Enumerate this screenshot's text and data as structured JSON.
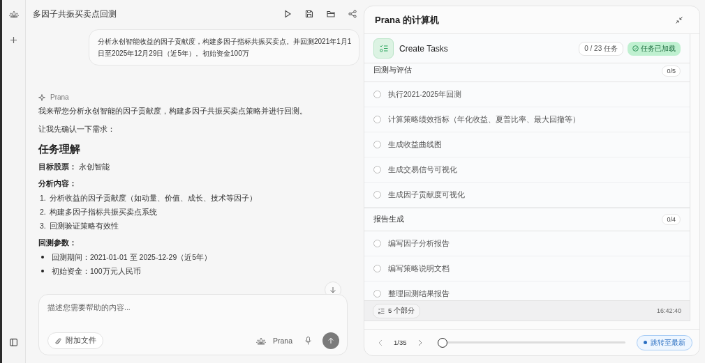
{
  "chat": {
    "title": "多因子共振买卖点回测",
    "user_message": "分析永创智能收益的因子贡献度，构建多因子指标共振买卖点。并回测2021年1月1日至2025年12月29日（近5年）。初始资金100万",
    "assistant_name": "Prana",
    "blocks": [
      {
        "kind": "p",
        "text": "我来帮您分析永创智能的因子贡献度，构建多因子共振买卖点策略并进行回测。"
      },
      {
        "kind": "p",
        "text": "让我先确认一下需求："
      },
      {
        "kind": "h",
        "text": "任务理解"
      },
      {
        "kind": "p",
        "text": "**目标股票：** 永创智能"
      },
      {
        "kind": "label",
        "text": "分析内容："
      },
      {
        "kind": "ol",
        "items": [
          {
            "number": "1.",
            "text": "分析收益的因子贡献度（如动量、价值、成长、技术等因子）"
          },
          {
            "number": "2.",
            "text": "构建多因子指标共振买卖点系统"
          },
          {
            "number": "3.",
            "text": "回测验证策略有效性"
          }
        ]
      },
      {
        "kind": "label",
        "text": "回测参数："
      },
      {
        "kind": "ul",
        "items": [
          {
            "text": "回测期间：2021-01-01 至 2025-12-29（近5年）"
          },
          {
            "text": "初始资金：100万元人民币"
          }
        ]
      }
    ],
    "input": {
      "placeholder": "描述您需要帮助的内容...",
      "attach": "附加文件",
      "model": "Prana"
    }
  },
  "panel": {
    "title": "Prana 的计算机",
    "tool": {
      "name": "Create Tasks",
      "count": "0 / 23 任务",
      "status": "任务已加载"
    },
    "sections": [
      {
        "title": "回测与评估",
        "count": "0/5",
        "tasks": [
          {
            "text": "执行2021-2025年回测",
            "done": false
          },
          {
            "text": "计算策略绩效指标（年化收益、夏普比率、最大回撤等）",
            "done": false
          },
          {
            "text": "生成收益曲线图",
            "done": false
          },
          {
            "text": "生成交易信号可视化",
            "done": false
          },
          {
            "text": "生成因子贡献度可视化",
            "done": false
          }
        ]
      },
      {
        "title": "报告生成",
        "count": "0/4",
        "tasks": [
          {
            "text": "编写因子分析报告",
            "done": false
          },
          {
            "text": "编写策略说明文档",
            "done": false
          },
          {
            "text": "整理回测结果报告",
            "done": false
          }
        ]
      }
    ],
    "footer": {
      "sections": "5 个部分",
      "time": "16:42:40"
    },
    "player": {
      "position": "1/35",
      "level": 0,
      "jump": "跳转至最新"
    }
  }
}
